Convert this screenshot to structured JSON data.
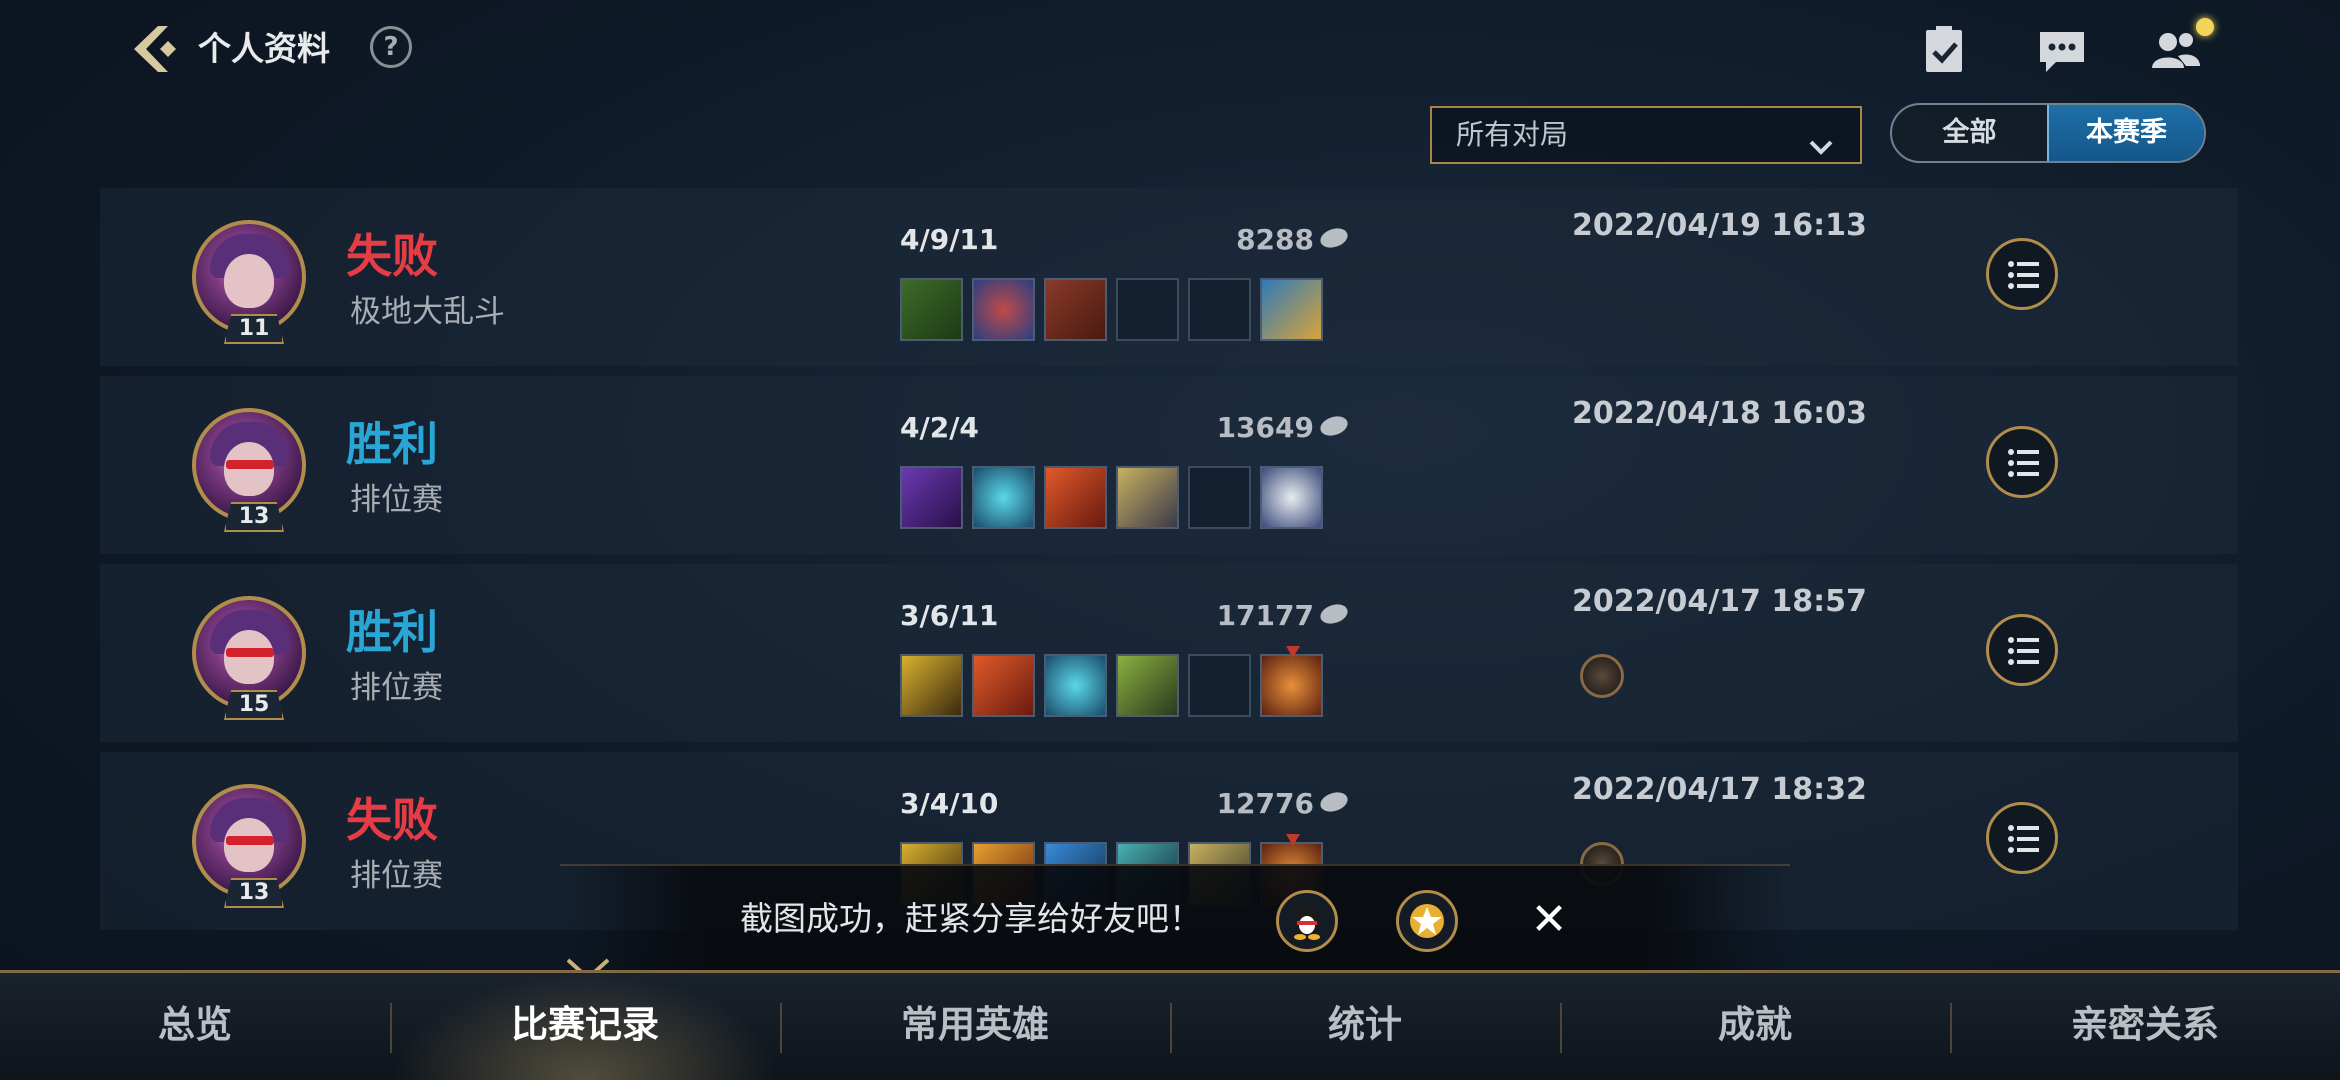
{
  "header": {
    "title": "个人资料",
    "help_label": "?"
  },
  "filters": {
    "match_type_selected": "所有对局",
    "season_options": [
      "全部",
      "本赛季"
    ],
    "season_selected": "本赛季"
  },
  "matches": [
    {
      "result": "失败",
      "result_status": "lose",
      "mode": "极地大乱斗",
      "level": "11",
      "kda": "4/9/11",
      "gold": "8288",
      "datetime": "2022/04/19 16:13"
    },
    {
      "result": "胜利",
      "result_status": "win",
      "mode": "排位赛",
      "level": "13",
      "kda": "4/2/4",
      "gold": "13649",
      "datetime": "2022/04/18 16:03"
    },
    {
      "result": "胜利",
      "result_status": "win",
      "mode": "排位赛",
      "level": "15",
      "kda": "3/6/11",
      "gold": "17177",
      "datetime": "2022/04/17 18:57"
    },
    {
      "result": "失败",
      "result_status": "lose",
      "mode": "排位赛",
      "level": "13",
      "kda": "3/4/10",
      "gold": "12776",
      "datetime": "2022/04/17 18:32"
    }
  ],
  "toast": {
    "message": "截图成功，赶紧分享给好友吧！"
  },
  "tabs": [
    {
      "label": "总览"
    },
    {
      "label": "比赛记录"
    },
    {
      "label": "常用英雄"
    },
    {
      "label": "统计"
    },
    {
      "label": "成就"
    },
    {
      "label": "亲密关系"
    }
  ],
  "active_tab": "比赛记录",
  "colors": {
    "lose": "#e63c45",
    "win": "#29a6d6",
    "gold_accent": "#b18d4c",
    "active_segment": "#1e6fa8"
  },
  "icons": {
    "back": "back-arrow-icon",
    "help": "question-icon",
    "tasks": "clipboard-check-icon",
    "chat": "chat-bubble-icon",
    "friends": "friends-icon",
    "detail": "list-icon",
    "share_qq": "qq-icon",
    "share_star": "star-icon",
    "close": "close-icon"
  }
}
